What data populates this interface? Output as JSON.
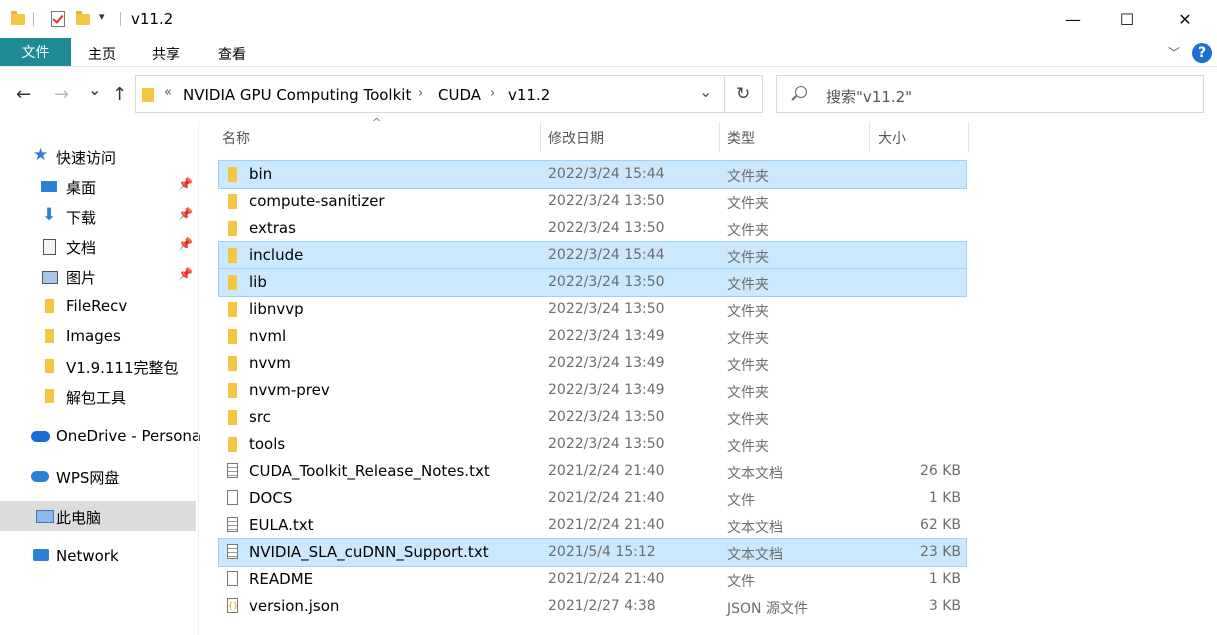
{
  "window": {
    "title": "v11.2",
    "minimize": "—",
    "maximize": "☐",
    "close": "✕",
    "qa_caret": "▾"
  },
  "ribbon": {
    "file": "文件",
    "tabs": [
      "主页",
      "共享",
      "查看"
    ],
    "chevron": "﹀",
    "help": "?"
  },
  "nav": {
    "back": "←",
    "forward": "→",
    "recent": "⌄",
    "up": "↑"
  },
  "address": {
    "lead": "«",
    "crumbs": [
      "NVIDIA GPU Computing Toolkit",
      "CUDA",
      "v11.2"
    ],
    "sep": "›",
    "dropdown": "⌄",
    "refresh": "↻"
  },
  "search": {
    "placeholder": "搜索\"v11.2\""
  },
  "sidebar": {
    "items": [
      {
        "label": "快速访问",
        "icon": "star-icon"
      },
      {
        "label": "桌面",
        "icon": "desktop-icon",
        "pinned": true
      },
      {
        "label": "下载",
        "icon": "download-icon",
        "pinned": true
      },
      {
        "label": "文档",
        "icon": "document-icon",
        "pinned": true
      },
      {
        "label": "图片",
        "icon": "picture-icon",
        "pinned": true
      },
      {
        "label": "FileRecv",
        "icon": "folder-icon"
      },
      {
        "label": "Images",
        "icon": "folder-icon"
      },
      {
        "label": "V1.9.111完整包",
        "icon": "folder-icon"
      },
      {
        "label": "解包工具",
        "icon": "folder-icon"
      },
      {
        "label": "OneDrive - Persona",
        "icon": "onedrive-icon"
      },
      {
        "label": "WPS网盘",
        "icon": "wps-cloud-icon"
      },
      {
        "label": "此电脑",
        "icon": "computer-icon",
        "selected": true
      },
      {
        "label": "Network",
        "icon": "network-icon"
      }
    ],
    "pin_glyph": "📌"
  },
  "columns": {
    "name": "名称",
    "date": "修改日期",
    "type": "类型",
    "size": "大小",
    "sort_glyph": "^"
  },
  "files": [
    {
      "name": "bin",
      "date": "2022/3/24 15:44",
      "type": "文件夹",
      "size": "",
      "kind": "folder",
      "selected": true
    },
    {
      "name": "compute-sanitizer",
      "date": "2022/3/24 13:50",
      "type": "文件夹",
      "size": "",
      "kind": "folder"
    },
    {
      "name": "extras",
      "date": "2022/3/24 13:50",
      "type": "文件夹",
      "size": "",
      "kind": "folder"
    },
    {
      "name": "include",
      "date": "2022/3/24 15:44",
      "type": "文件夹",
      "size": "",
      "kind": "folder",
      "selected": true
    },
    {
      "name": "lib",
      "date": "2022/3/24 13:50",
      "type": "文件夹",
      "size": "",
      "kind": "folder",
      "selected": true
    },
    {
      "name": "libnvvp",
      "date": "2022/3/24 13:50",
      "type": "文件夹",
      "size": "",
      "kind": "folder"
    },
    {
      "name": "nvml",
      "date": "2022/3/24 13:49",
      "type": "文件夹",
      "size": "",
      "kind": "folder"
    },
    {
      "name": "nvvm",
      "date": "2022/3/24 13:49",
      "type": "文件夹",
      "size": "",
      "kind": "folder"
    },
    {
      "name": "nvvm-prev",
      "date": "2022/3/24 13:49",
      "type": "文件夹",
      "size": "",
      "kind": "folder"
    },
    {
      "name": "src",
      "date": "2022/3/24 13:50",
      "type": "文件夹",
      "size": "",
      "kind": "folder"
    },
    {
      "name": "tools",
      "date": "2022/3/24 13:50",
      "type": "文件夹",
      "size": "",
      "kind": "folder"
    },
    {
      "name": "CUDA_Toolkit_Release_Notes.txt",
      "date": "2021/2/24 21:40",
      "type": "文本文档",
      "size": "26 KB",
      "kind": "text"
    },
    {
      "name": "DOCS",
      "date": "2021/2/24 21:40",
      "type": "文件",
      "size": "1 KB",
      "kind": "file"
    },
    {
      "name": "EULA.txt",
      "date": "2021/2/24 21:40",
      "type": "文本文档",
      "size": "62 KB",
      "kind": "text"
    },
    {
      "name": "NVIDIA_SLA_cuDNN_Support.txt",
      "date": "2021/5/4 15:12",
      "type": "文本文档",
      "size": "23 KB",
      "kind": "text",
      "selected": true
    },
    {
      "name": "README",
      "date": "2021/2/24 21:40",
      "type": "文件",
      "size": "1 KB",
      "kind": "file"
    },
    {
      "name": "version.json",
      "date": "2021/2/27 4:38",
      "type": "JSON 源文件",
      "size": "3 KB",
      "kind": "json"
    }
  ],
  "colors": {
    "accent": "#1f8c95",
    "selection": "#cce8ff",
    "folder": "#f5c642"
  }
}
